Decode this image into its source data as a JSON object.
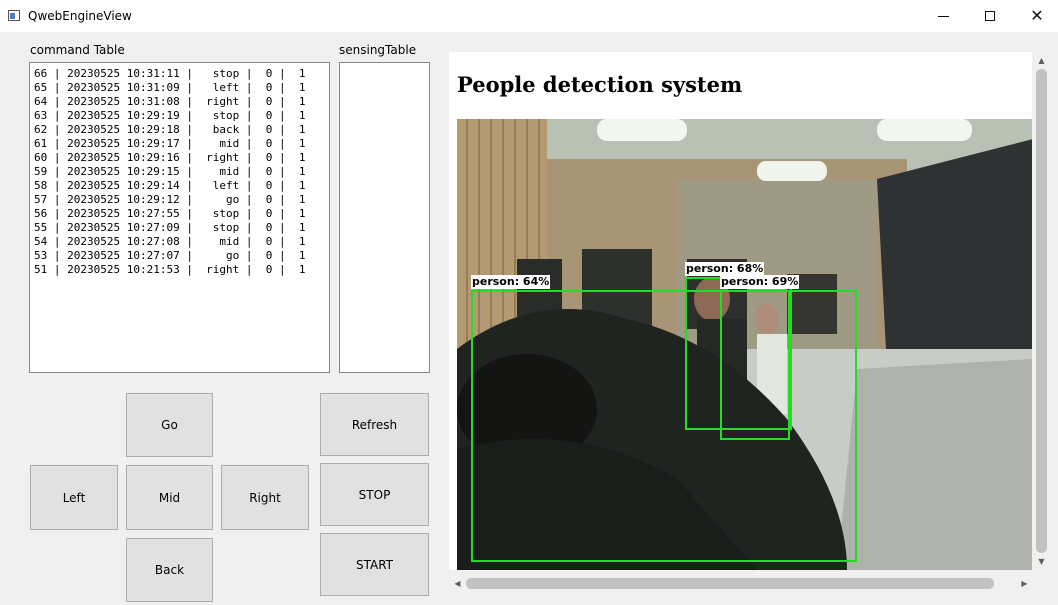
{
  "window": {
    "title": "QwebEngineView",
    "icon": "app-window-icon",
    "controls": {
      "minimize": "minimize-icon",
      "maximize": "maximize-icon",
      "close": "close-icon",
      "close_glyph": "✕"
    }
  },
  "command_table": {
    "label": "command Table",
    "rows": [
      "66 | 20230525 10:31:11 |   stop |  0 |  1",
      "65 | 20230525 10:31:09 |   left |  0 |  1",
      "64 | 20230525 10:31:08 |  right |  0 |  1",
      "63 | 20230525 10:29:19 |   stop |  0 |  1",
      "62 | 20230525 10:29:18 |   back |  0 |  1",
      "61 | 20230525 10:29:17 |    mid |  0 |  1",
      "60 | 20230525 10:29:16 |  right |  0 |  1",
      "59 | 20230525 10:29:15 |    mid |  0 |  1",
      "58 | 20230525 10:29:14 |   left |  0 |  1",
      "57 | 20230525 10:29:12 |     go |  0 |  1",
      "56 | 20230525 10:27:55 |   stop |  0 |  1",
      "55 | 20230525 10:27:09 |   stop |  0 |  1",
      "54 | 20230525 10:27:08 |    mid |  0 |  1",
      "53 | 20230525 10:27:07 |     go |  0 |  1",
      "51 | 20230525 10:21:53 |  right |  0 |  1"
    ]
  },
  "sensing_table": {
    "label": "sensingTable"
  },
  "controls": {
    "go": "Go",
    "left": "Left",
    "mid": "Mid",
    "right": "Right",
    "back": "Back",
    "refresh": "Refresh",
    "stop": "STOP",
    "start": "START"
  },
  "web": {
    "page_title": "People detection system",
    "detections": [
      {
        "label": "person: 64%"
      },
      {
        "label": "person: 68%"
      },
      {
        "label": "person: 69%"
      }
    ],
    "box_color": "#22dd22"
  },
  "scrollbars": {
    "up": "▲",
    "down": "▼",
    "left": "◀",
    "right": "▶"
  }
}
